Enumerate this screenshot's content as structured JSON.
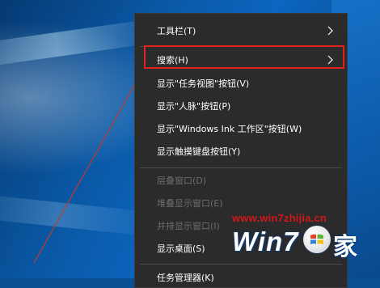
{
  "menu": {
    "items": [
      {
        "label": "工具栏(T)",
        "has_submenu": true,
        "enabled": true
      },
      {
        "label": "搜索(H)",
        "has_submenu": true,
        "enabled": true,
        "highlighted": true
      },
      {
        "label": "显示\"任务视图\"按钮(V)",
        "enabled": true
      },
      {
        "label": "显示\"人脉\"按钮(P)",
        "enabled": true
      },
      {
        "label": "显示\"Windows Ink 工作区\"按钮(W)",
        "enabled": true
      },
      {
        "label": "显示触摸键盘按钮(Y)",
        "enabled": true
      },
      {
        "label": "层叠窗口(D)",
        "enabled": false
      },
      {
        "label": "堆叠显示窗口(E)",
        "enabled": false
      },
      {
        "label": "并排显示窗口(I)",
        "enabled": false
      },
      {
        "label": "显示桌面(S)",
        "enabled": true
      },
      {
        "label": "任务管理器(K)",
        "enabled": true
      }
    ]
  },
  "annotation": {
    "highlight_color": "#e2211c",
    "arrow_color": "#c0392b"
  },
  "watermark": {
    "url": "www.win7zhijia.cn",
    "logo_text": "Win7",
    "logo_char": "家"
  },
  "icons": {
    "submenu_arrow": "chevron-right-icon",
    "windows_logo": "windows-logo-icon"
  }
}
